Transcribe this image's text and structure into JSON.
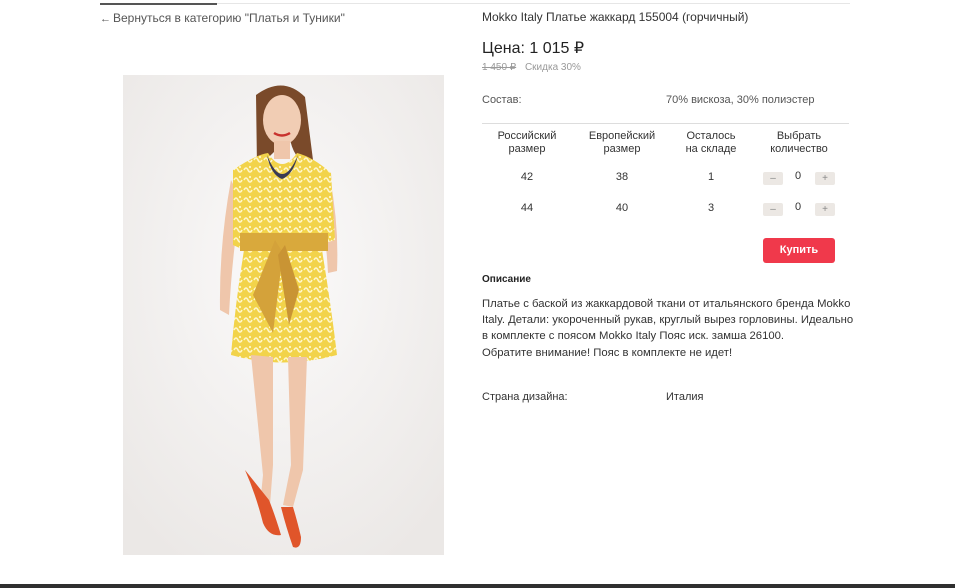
{
  "nav": {
    "back_arrow": "←",
    "back_link": "Вернуться в категорию \"Платья и Туники\""
  },
  "product": {
    "title": "Mokko Italy Платье жаккард 155004 (горчичный)",
    "price": "Цена: 1 015 ₽",
    "old_price": "1 450 ₽",
    "discount": "Скидка 30%",
    "composition_label": "Состав:",
    "composition_value": "70% вискоза, 30% полиэстер"
  },
  "size_table": {
    "headers": {
      "russian_line1": "Российский",
      "russian_line2": "размер",
      "european_line1": "Европейский",
      "european_line2": "размер",
      "stock_line1": "Осталось",
      "stock_line2": "на складе",
      "choose_line1": "Выбрать",
      "choose_line2": "количество"
    },
    "rows": [
      {
        "russian": "42",
        "european": "38",
        "stock": "1",
        "qty": "0",
        "minus": "–",
        "plus": "+"
      },
      {
        "russian": "44",
        "european": "40",
        "stock": "3",
        "qty": "0",
        "minus": "–",
        "plus": "+"
      }
    ]
  },
  "buy_button": "Купить",
  "description": {
    "heading": "Описание",
    "line1": "Платье с баской из жаккардовой ткани от итальянского бренда Mokko Italy. Детали: укороченный рукав, круглый вырез горловины. Идеально в комплекте с поясом Mokko Italy Пояс иск. замша 26100.",
    "line2": "Обратите внимание! Пояс в комплекте не идет!"
  },
  "country": {
    "label": "Страна дизайна:",
    "value": "Италия"
  },
  "colors": {
    "accent": "#f0394b",
    "dress": "#f0d24a"
  }
}
